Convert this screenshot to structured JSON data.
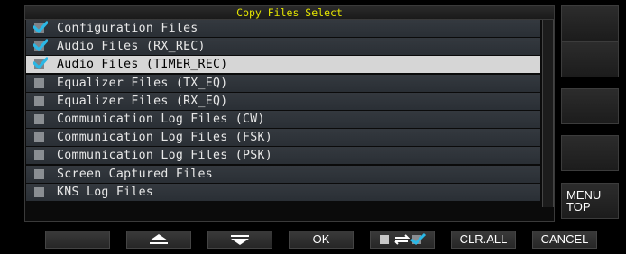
{
  "dialog": {
    "title": "Copy Files Select"
  },
  "items": [
    {
      "label": "Configuration Files",
      "checked": true,
      "selected": false
    },
    {
      "label": "Audio Files (RX_REC)",
      "checked": true,
      "selected": false
    },
    {
      "label": "Audio Files (TIMER_REC)",
      "checked": true,
      "selected": true
    },
    {
      "label": "Equalizer Files (TX_EQ)",
      "checked": false,
      "selected": false
    },
    {
      "label": "Equalizer Files (RX_EQ)",
      "checked": false,
      "selected": false
    },
    {
      "label": "Communication Log Files (CW)",
      "checked": false,
      "selected": false
    },
    {
      "label": "Communication Log Files (FSK)",
      "checked": false,
      "selected": false
    },
    {
      "label": "Communication Log Files (PSK)",
      "checked": false,
      "selected": false
    },
    {
      "label": "Screen Captured Files",
      "checked": false,
      "selected": false
    },
    {
      "label": "KNS Log Files",
      "checked": false,
      "selected": false
    }
  ],
  "side_buttons": {
    "menu_top": "MENU\nTOP"
  },
  "bottom_bar": {
    "ok": "OK",
    "clr_all": "CLR.ALL",
    "cancel": "CANCEL"
  },
  "colors": {
    "title": "#e6e600",
    "check": "#2bb8e6",
    "selected_row": "#d6d6d6"
  }
}
